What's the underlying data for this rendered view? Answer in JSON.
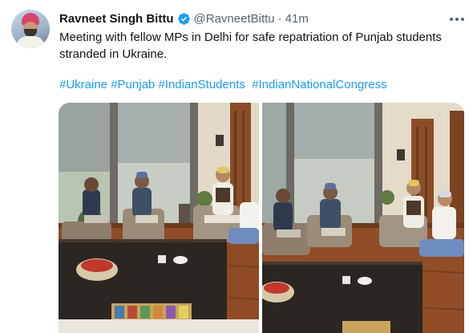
{
  "author": {
    "display_name": "Ravneet Singh Bittu",
    "handle": "@RavneetBittu",
    "separator": "·",
    "timestamp": "41m",
    "verified": true,
    "avatar_icon": "profile-avatar"
  },
  "tweet": {
    "text": "Meeting with fellow MPs in Delhi for safe repatriation of Punjab students stranded in Ukraine.",
    "hashtags": [
      "#Ukraine",
      "#Punjab",
      "#IndianStudents",
      "#IndianNationalCongress"
    ]
  },
  "media": {
    "photo_count": 2,
    "photos": [
      {
        "icon": "meeting-photo-1"
      },
      {
        "icon": "meeting-photo-2"
      }
    ]
  },
  "icons": {
    "verified": "verified-badge-icon",
    "more": "more-options-icon"
  },
  "colors": {
    "text": "#0f1419",
    "secondary": "#536471",
    "link": "#1d9bf0",
    "verified": "#1d9bf0"
  }
}
